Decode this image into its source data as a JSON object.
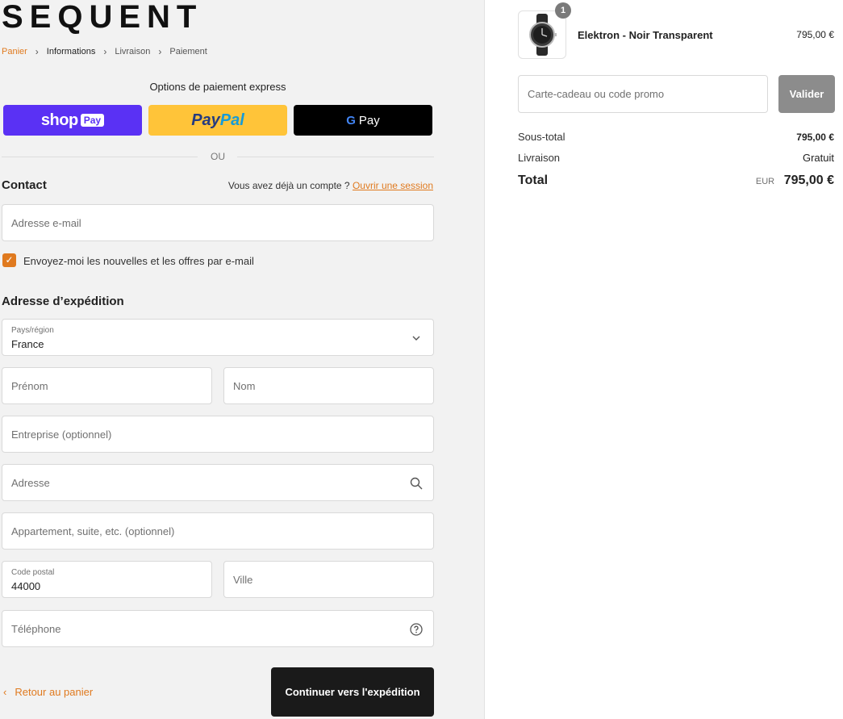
{
  "brand": {
    "logo": "SEQUENT"
  },
  "breadcrumb": [
    {
      "label": "Panier"
    },
    {
      "label": "Informations"
    },
    {
      "label": "Livraison"
    },
    {
      "label": "Paiement"
    }
  ],
  "express": {
    "title": "Options de paiement express",
    "shop_pay": {
      "word": "shop",
      "badge": "Pay"
    },
    "paypal": {
      "part1": "Pay",
      "part2": "Pal"
    },
    "gpay": {
      "g": "G",
      "label": "Pay"
    },
    "or_label": "OU"
  },
  "contact": {
    "title": "Contact",
    "account_prompt": "Vous avez déjà un compte ?",
    "login_link": "Ouvrir une session",
    "email_placeholder": "Adresse e-mail",
    "newsletter_label": "Envoyez-moi les nouvelles et les offres par e-mail",
    "newsletter_checked": true
  },
  "shipping": {
    "title": "Adresse d’expédition",
    "country_label": "Pays/région",
    "country_value": "France",
    "first_name": "Prénom",
    "last_name": "Nom",
    "company": "Entreprise (optionnel)",
    "address": "Adresse",
    "apartment": "Appartement, suite, etc. (optionnel)",
    "postal_label": "Code postal",
    "postal_value": "44000",
    "city": "Ville",
    "phone": "Téléphone"
  },
  "actions": {
    "back_label": "Retour au panier",
    "continue_label": "Continuer vers l'expédition"
  },
  "order": {
    "product": {
      "name": "Elektron - Noir Transparent",
      "price": "795,00 €",
      "quantity": "1"
    },
    "promo_placeholder": "Carte-cadeau ou code promo",
    "apply_label": "Valider",
    "subtotal_label": "Sous-total",
    "subtotal_value": "795,00 €",
    "shipping_label": "Livraison",
    "shipping_value": "Gratuit",
    "total_label": "Total",
    "total_currency": "EUR",
    "total_value": "795,00 €"
  },
  "colors": {
    "accent": "#e07a1f",
    "shop_pay": "#5a31f4",
    "paypal": "#ffc439",
    "gpay": "#000000",
    "primary_button": "#1a1a1a",
    "apply_button": "#8c8c8c"
  }
}
